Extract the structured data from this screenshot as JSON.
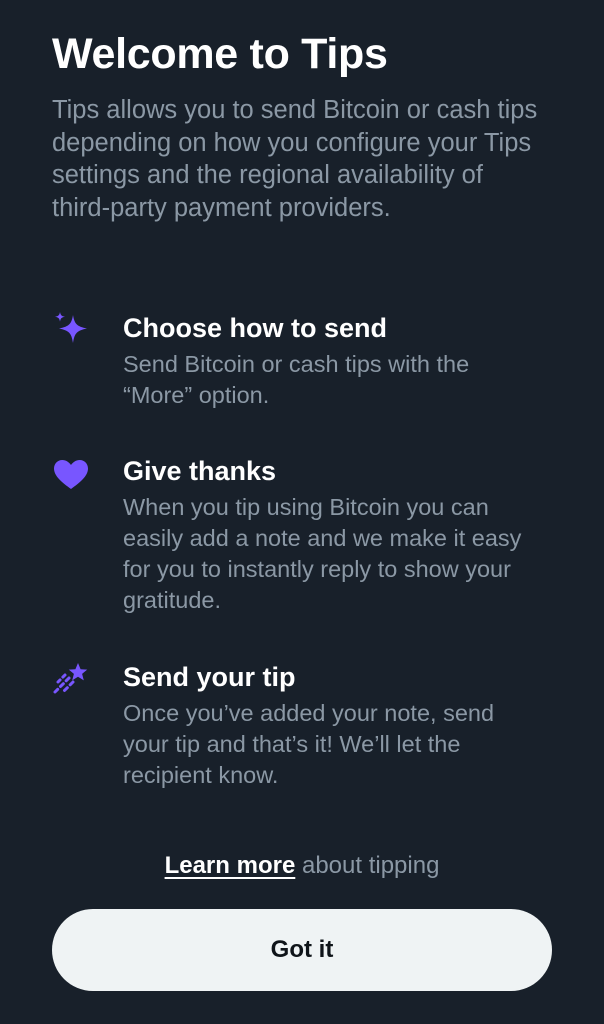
{
  "header": {
    "title": "Welcome to Tips",
    "intro": "Tips allows you to send Bitcoin or cash tips depending on how you configure your Tips settings and the regional availability of third-party payment providers."
  },
  "features": [
    {
      "icon": "sparkle-icon",
      "title": "Choose how to send",
      "description": "Send Bitcoin or cash tips with the “More” option."
    },
    {
      "icon": "heart-icon",
      "title": "Give thanks",
      "description": "When you tip using Bitcoin you can easily add a note and we make it easy for you to instantly reply to show your gratitude."
    },
    {
      "icon": "shooting-star-icon",
      "title": "Send your tip",
      "description": "Once you’ve added your note, send your tip and that’s it! We’ll let the recipient know."
    }
  ],
  "footer": {
    "learn_more_link": "Learn more",
    "learn_more_suffix": " about tipping",
    "confirm_button": "Got it"
  },
  "colors": {
    "background": "#18202a",
    "accent_icon": "#7856ff",
    "primary_text": "#ffffff",
    "secondary_text": "#8b98a5",
    "button_bg": "#eff3f4",
    "button_text": "#0f1419"
  }
}
